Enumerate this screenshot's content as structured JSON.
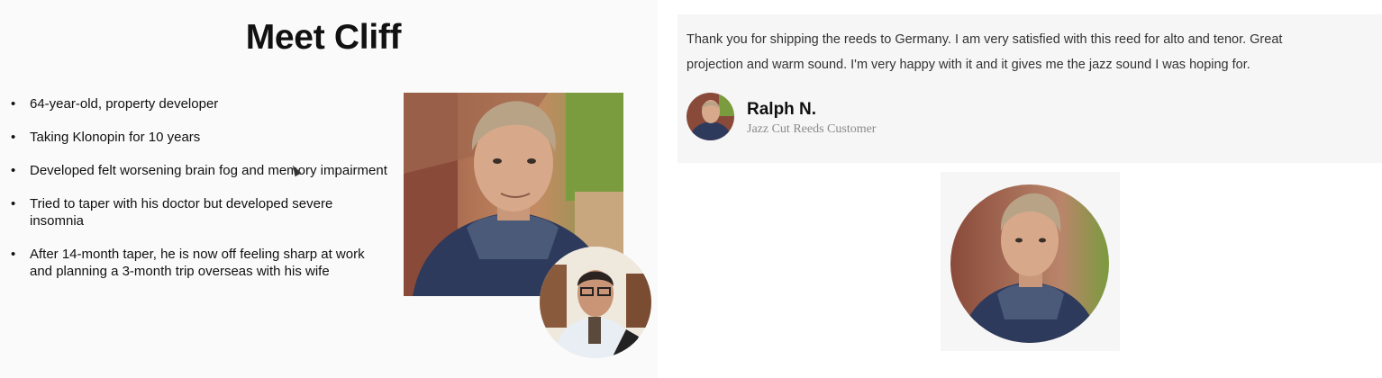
{
  "slide": {
    "title": "Meet Cliff",
    "bullet_glyph": "•",
    "bullets": [
      "64-year-old, property developer",
      "Taking Klonopin for 10 years",
      "Developed felt worsening brain fog and memory impairment",
      "Tried to taper with his doctor but developed severe insomnia",
      "After 14-month taper, he is now off feeling sharp at work and planning a 3-month trip overseas with his wife"
    ]
  },
  "testimonial": {
    "quote": "Thank you for shipping the reeds to Germany. I am very satisfied with this reed for alto and tenor. Great projection and warm sound. I'm very happy with it and it gives me the jazz sound I was hoping for.",
    "author_name": "Ralph N.",
    "author_role": "Jazz Cut Reeds Customer"
  },
  "colors": {
    "jacket": "#2e3a5c",
    "hood": "#4a5a78",
    "skin": "#d7a98a",
    "hair": "#b9a387",
    "building": "#8a4a3a"
  }
}
